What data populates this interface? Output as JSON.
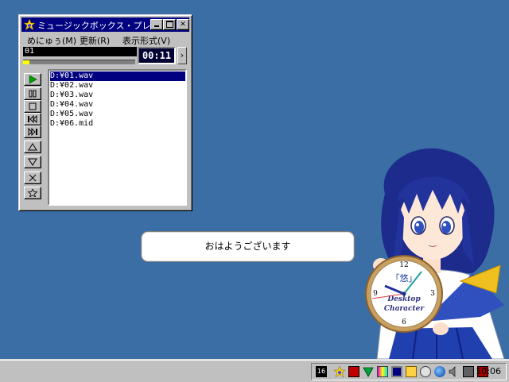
{
  "player": {
    "title": "ミュージックボックス・プレイリ...",
    "menu": [
      "めにゅぅ(M)",
      "更新(R)",
      "表示形式(V)"
    ],
    "track_display": "01",
    "time": "00:11",
    "seek_progress": 0.06,
    "controls": [
      "play",
      "pause",
      "stop",
      "previous",
      "next",
      "move-up",
      "move-down",
      "delete",
      "favorite"
    ],
    "playlist": [
      "D:¥01.wav",
      "D:¥02.wav",
      "D:¥03.wav",
      "D:¥04.wav",
      "D:¥05.wav",
      "D:¥06.mid"
    ],
    "selected_index": 0
  },
  "balloon": {
    "text": "おはようございます"
  },
  "character": {
    "clock_lines": [
      "「悠」",
      "Desktop",
      "Character"
    ],
    "clock_numbers": [
      "12",
      "3",
      "6",
      "9"
    ]
  },
  "taskbar": {
    "clock": "10:06",
    "tray_icons": [
      "ime-16-icon",
      "music-box-icon",
      "keyboard-icon",
      "antivirus-icon",
      "palette-icon",
      "monitor-icon",
      "network-icon",
      "cd-icon",
      "globe-icon",
      "speaker-icon",
      "printer-icon",
      "app-icon"
    ]
  },
  "colors": {
    "desktop": "#3a6ea5",
    "titlebar": "#000080",
    "hair": "#1a2a8a",
    "ribbon": "#f0c020"
  }
}
